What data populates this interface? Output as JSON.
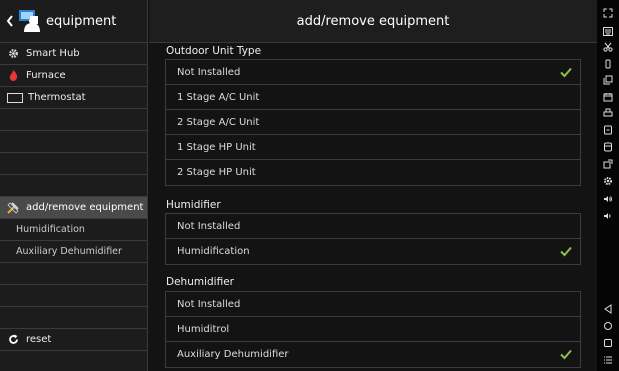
{
  "left": {
    "title": "equipment",
    "items": [
      {
        "label": "Smart Hub"
      },
      {
        "label": "Furnace"
      },
      {
        "label": "Thermostat"
      }
    ],
    "selected": {
      "label": "add/remove equipment"
    },
    "subitems": [
      {
        "label": "Humidification"
      },
      {
        "label": "Auxiliary Dehumidifier"
      }
    ],
    "reset": {
      "label": "reset"
    }
  },
  "main": {
    "title": "add/remove equipment",
    "sections": [
      {
        "title": "Outdoor Unit Type",
        "options": [
          {
            "label": "Not Installed",
            "checked": true
          },
          {
            "label": "1 Stage A/C Unit",
            "checked": false
          },
          {
            "label": "2 Stage A/C Unit",
            "checked": false
          },
          {
            "label": "1 Stage HP Unit",
            "checked": false
          },
          {
            "label": "2 Stage HP Unit",
            "checked": false
          }
        ]
      },
      {
        "title": "Humidifier",
        "options": [
          {
            "label": "Not Installed",
            "checked": false
          },
          {
            "label": "Humidification",
            "checked": true
          }
        ]
      },
      {
        "title": "Dehumidifier",
        "options": [
          {
            "label": "Not Installed",
            "checked": false
          },
          {
            "label": "Humiditrol",
            "checked": false
          },
          {
            "label": "Auxiliary Dehumidifier",
            "checked": true
          }
        ]
      }
    ]
  },
  "colors": {
    "check": "#8bc34a",
    "flame": "#e53935",
    "selected_bg": "#4a4a4a"
  },
  "sysbar_icons": [
    "fullscreen-icon",
    "keyboard-icon",
    "scissors-icon",
    "rotate-icon",
    "copy-icon",
    "calendar-icon",
    "printer-icon",
    "app-icon",
    "tablet-icon",
    "export-icon",
    "settings-icon",
    "volume-up-icon",
    "volume-down-icon",
    "back-nav-icon",
    "home-nav-icon",
    "recents-nav-icon",
    "menu-nav-icon"
  ]
}
